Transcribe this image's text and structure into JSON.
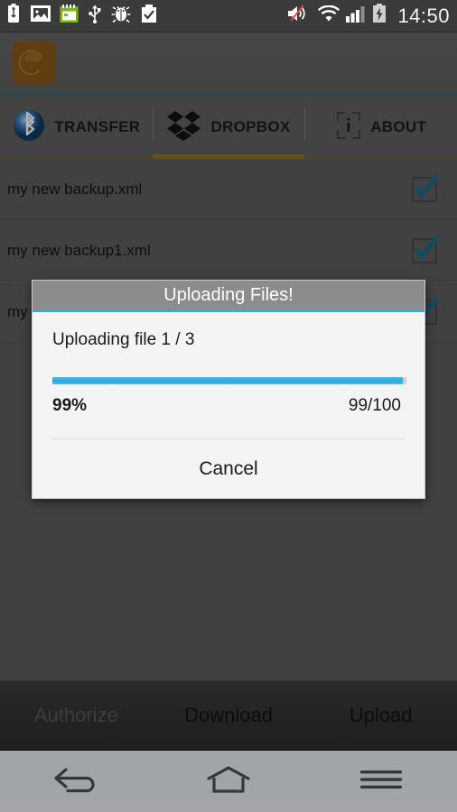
{
  "status_bar": {
    "time": "14:50",
    "left_icons": [
      {
        "name": "usb-battery-icon"
      },
      {
        "name": "image-icon"
      },
      {
        "name": "calendar-icon"
      },
      {
        "name": "usb-icon"
      },
      {
        "name": "debug-bug-icon"
      },
      {
        "name": "clipboard-check-icon"
      }
    ],
    "right_icons": [
      {
        "name": "volume-muted-icon"
      },
      {
        "name": "wifi-icon"
      },
      {
        "name": "cellular-signal-icon",
        "bars": 3,
        "total_bars": 4
      },
      {
        "name": "battery-charging-icon"
      }
    ]
  },
  "action_bar": {
    "app_icon": "cloud-sync-icon",
    "accent_color": "#2f6f82"
  },
  "tabs": [
    {
      "label": "TRANSFER",
      "icon": "bluetooth-icon",
      "active": false
    },
    {
      "label": "DROPBOX",
      "icon": "dropbox-icon",
      "active": true
    },
    {
      "label": "ABOUT",
      "icon": "info-icon",
      "active": false
    }
  ],
  "file_list": [
    {
      "name": "my new backup.xml",
      "checked": true
    },
    {
      "name": "my new backup1.xml",
      "checked": true
    },
    {
      "name": "my new backup2.xml",
      "checked": true
    }
  ],
  "bottom_bar": {
    "buttons": [
      {
        "label": "Authorize",
        "disabled": true
      },
      {
        "label": "Download",
        "disabled": false
      },
      {
        "label": "Upload",
        "disabled": false
      }
    ]
  },
  "dialog": {
    "title": "Uploading Files!",
    "message": "Uploading file 1 / 3",
    "percent_label": "99%",
    "count_label": "99/100",
    "progress_value": 99,
    "progress_max": 100,
    "cancel_label": "Cancel",
    "accent_color": "#22b2e8"
  },
  "nav_bar": {
    "buttons": [
      {
        "name": "back-icon"
      },
      {
        "name": "home-icon"
      },
      {
        "name": "menu-icon"
      }
    ]
  }
}
